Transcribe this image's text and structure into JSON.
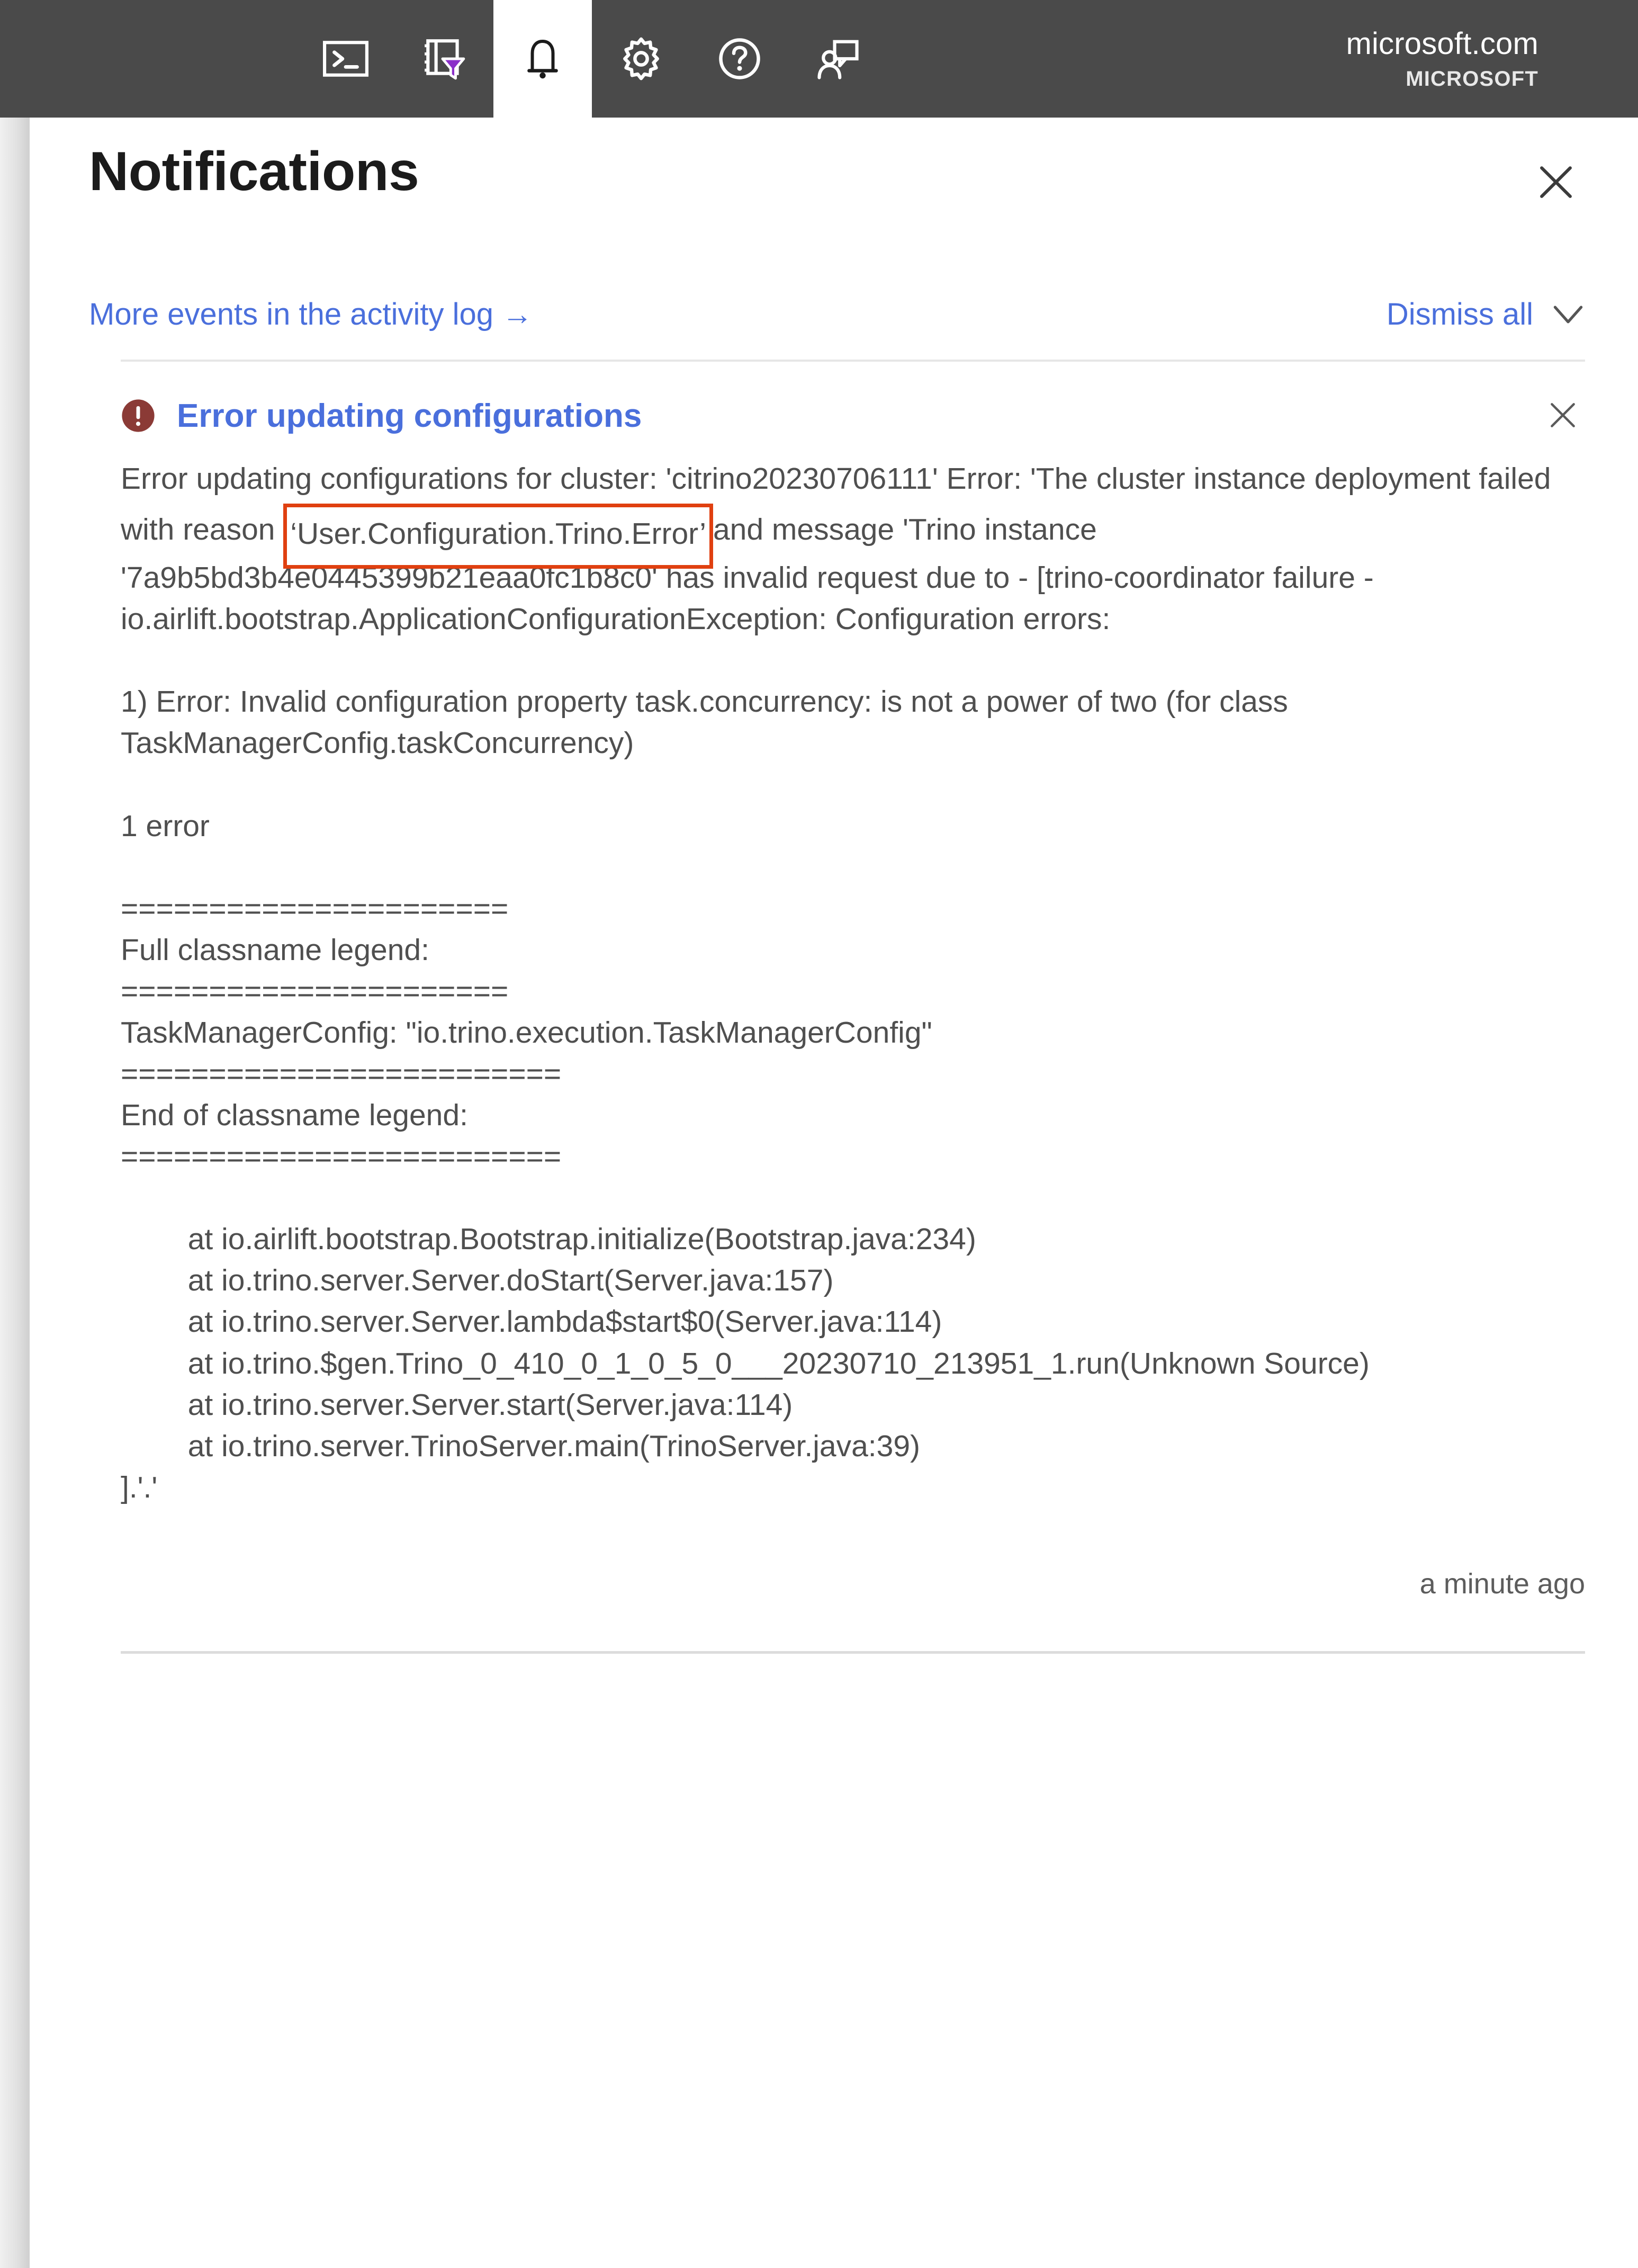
{
  "topbar": {
    "icons": [
      {
        "name": "cloud-shell-icon",
        "label": "Cloud Shell"
      },
      {
        "name": "directories-filter-icon",
        "label": "Directories + subscriptions"
      },
      {
        "name": "notifications-bell-icon",
        "label": "Notifications"
      },
      {
        "name": "gear-icon",
        "label": "Settings"
      },
      {
        "name": "help-question-icon",
        "label": "Help"
      },
      {
        "name": "feedback-person-icon",
        "label": "Feedback"
      }
    ],
    "account_name": "microsoft.com",
    "account_org": "MICROSOFT"
  },
  "panel": {
    "title": "Notifications",
    "close_label": "Close",
    "more_events_link": "More events in the activity log →",
    "dismiss_all_label": "Dismiss all"
  },
  "notification": {
    "severity": "error",
    "title": "Error updating configurations",
    "close_label": "Dismiss",
    "timestamp": "a minute ago",
    "body_pre": "Error updating configurations for cluster: 'citrino20230706111' Error: 'The cluster instance deployment failed with reason ",
    "body_highlight": "‘User.Configuration.Trino.Error’",
    "body_post": "and message 'Trino instance '7a9b5bd3b4e0445399b21eaa0fc1b8c0' has invalid request due to - [trino-coordinator failure - io.airlift.bootstrap.ApplicationConfigurationException: Configuration errors:\n\n1) Error: Invalid configuration property task.concurrency: is not a power of two (for class TaskManagerConfig.taskConcurrency)\n\n1 error\n\n======================\nFull classname legend:\n======================\nTaskManagerConfig: \"io.trino.execution.TaskManagerConfig\"\n=========================\nEnd of classname legend:\n=========================\n\n\tat io.airlift.bootstrap.Bootstrap.initialize(Bootstrap.java:234)\n\tat io.trino.server.Server.doStart(Server.java:157)\n\tat io.trino.server.Server.lambda$start$0(Server.java:114)\n\tat io.trino.$gen.Trino_0_410_0_1_0_5_0___20230710_213951_1.run(Unknown Source)\n\tat io.trino.server.Server.start(Server.java:114)\n\tat io.trino.server.TrinoServer.main(TrinoServer.java:39)\n].'.'",
    "highlight_color": "#e04010"
  },
  "colors": {
    "topbar_bg": "#4a4a4a",
    "link": "#4a6fdc",
    "error_icon": "#8b3a36",
    "body_text": "#4f4f4f",
    "highlight_border": "#e04010"
  }
}
